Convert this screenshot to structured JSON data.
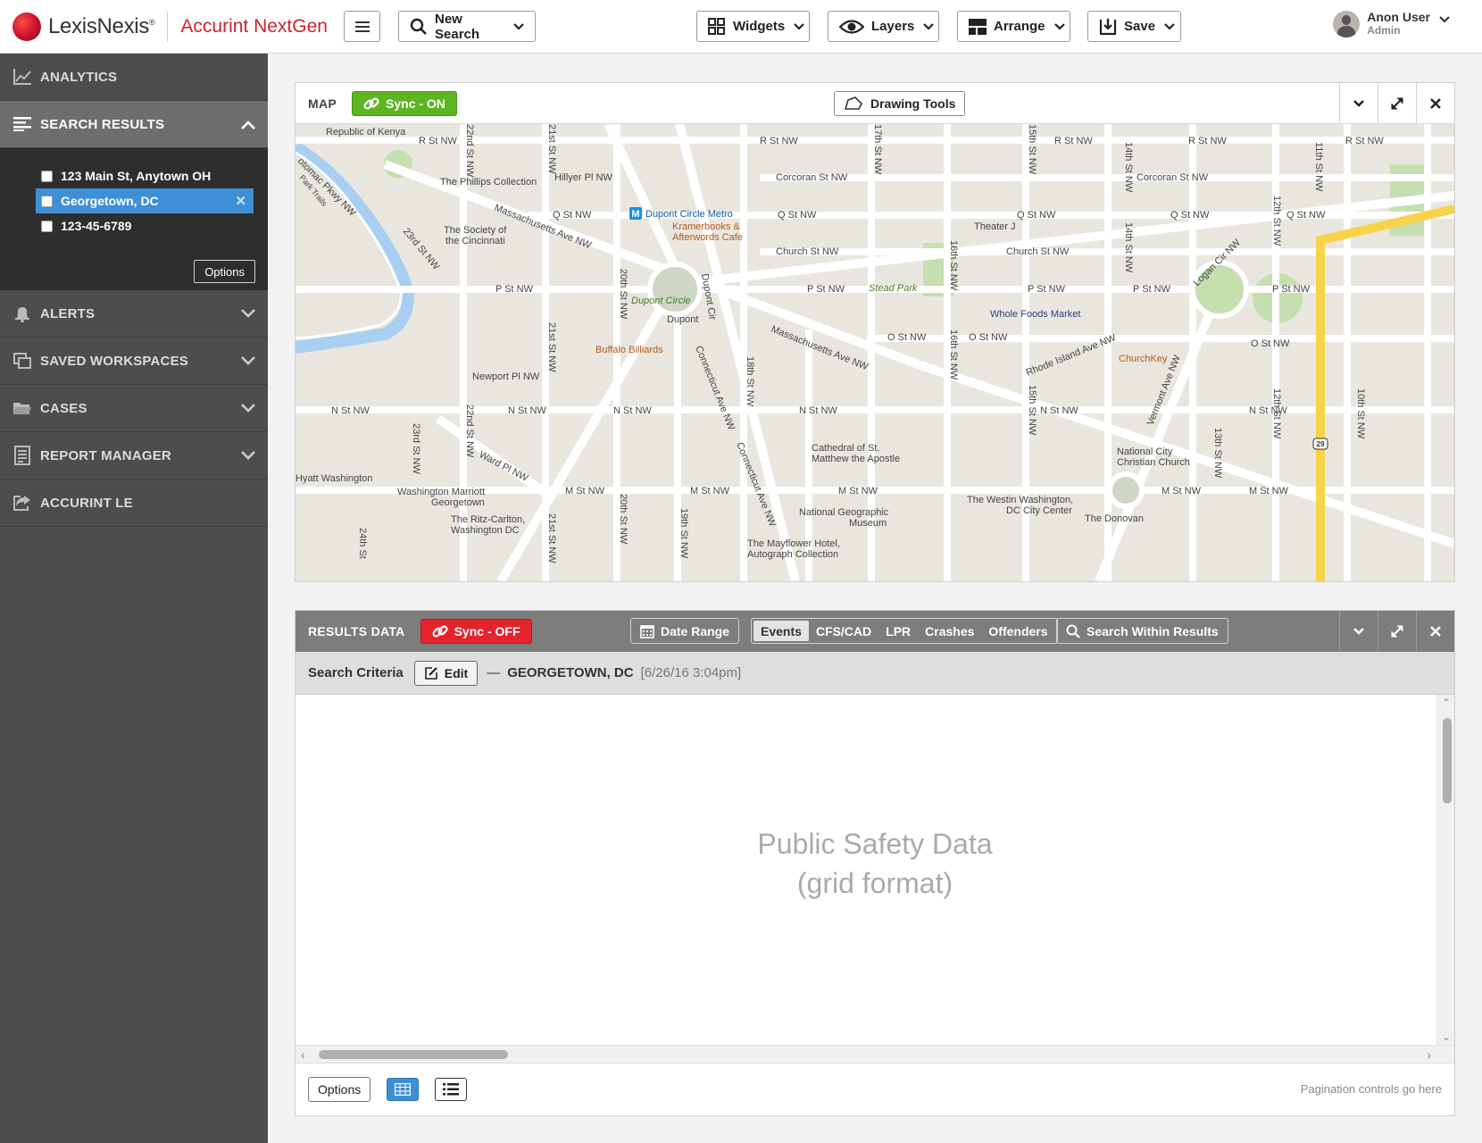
{
  "brand": {
    "company": "LexisNexis",
    "registered": "®",
    "product": "Accurint NextGen"
  },
  "toolbar": {
    "new_search": "New Search",
    "widgets": "Widgets",
    "layers": "Layers",
    "arrange": "Arrange",
    "save": "Save"
  },
  "user": {
    "name": "Anon User",
    "role": "Admin"
  },
  "sidebar": {
    "items": [
      {
        "label": "ANALYTICS",
        "icon": "chart-icon"
      },
      {
        "label": "SEARCH RESULTS",
        "icon": "list-icon"
      },
      {
        "label": "ALERTS",
        "icon": "bell-icon"
      },
      {
        "label": "SAVED WORKSPACES",
        "icon": "workspaces-icon"
      },
      {
        "label": "CASES",
        "icon": "folder-icon"
      },
      {
        "label": "REPORT MANAGER",
        "icon": "report-icon"
      },
      {
        "label": "ACCURINT LE",
        "icon": "share-icon"
      }
    ],
    "search_results": [
      {
        "label": "123 Main St, Anytown OH",
        "selected": false
      },
      {
        "label": "Georgetown, DC",
        "selected": true
      },
      {
        "label": "123-45-6789",
        "selected": false
      }
    ],
    "options_label": "Options"
  },
  "map_widget": {
    "title": "MAP",
    "sync_label": "Sync - ON",
    "drawing_tools": "Drawing Tools",
    "streets": {
      "r": "R St NW",
      "q": "Q St NW",
      "p": "P St NW",
      "o": "O St NW",
      "n": "N St NW",
      "m": "M St NW",
      "corcoran": "Corcoran St NW",
      "church": "Church St NW",
      "hillyer": "Hillyer Pl NW",
      "newport": "Newport Pl NW",
      "ward": "Ward Pl NW",
      "mass": "Massachusetts Ave NW",
      "conn": "Connecticut Ave NW",
      "rhode": "Rhode Island Ave NW",
      "vermont": "Vermont Ave NW",
      "logan": "Logan Cir NW",
      "potomac": "otomac Pkwy NW",
      "park_trails": "Park Trails",
      "s22": "22nd St NW",
      "s23": "23rd St NW",
      "s21": "21st St NW",
      "s20": "20th St NW",
      "s19": "19th St NW",
      "s18": "18th St NW",
      "s17": "17th St NW",
      "s16": "16th St NW",
      "s15": "15th St NW",
      "s14": "14th St NW",
      "s13": "13th St NW",
      "s12": "12th St NW",
      "s11": "11th St NW",
      "s10": "10th St NW",
      "s24": "24th St",
      "dupont": "Dupont",
      "dupont_cir": "Dupont Cir",
      "route": "29"
    },
    "places": {
      "kenya": "Republic of Kenya",
      "phillips": "The Phillips Collection",
      "society": "The Society of",
      "society2": "the Cincinnati",
      "metro": "Dupont Circle Metro",
      "kramer": "Kramerbooks &",
      "kramer2": "Afterwords Cafe",
      "dupont_circle": "Dupont Circle",
      "buffalo": "Buffalo Billiards",
      "theater": "Theater J",
      "stead": "Stead Park",
      "wholefoods": "Whole Foods Market",
      "churchkey": "ChurchKey",
      "cathedral": "Cathedral of St.",
      "cathedral2": "Matthew the Apostle",
      "natcity": "National City",
      "natcity2": "Christian Church",
      "hyatt": "Hyatt Washington",
      "marriott": "Washington Marriott",
      "marriott2": "Georgetown",
      "ritz": "The Ritz-Carlton,",
      "ritz2": "Washington DC",
      "natgeo": "National Geographic",
      "natgeo2": "Museum",
      "westin": "The Westin Washington,",
      "westin2": "DC City Center",
      "donovan": "The Donovan",
      "mayflower": "The Mayflower Hotel,",
      "mayflower2": "Autograph Collection"
    }
  },
  "results_widget": {
    "title": "RESULTS DATA",
    "sync_label": "Sync - OFF",
    "date_range": "Date Range",
    "tabs": [
      {
        "label": "Events",
        "active": true
      },
      {
        "label": "CFS/CAD",
        "active": false
      },
      {
        "label": "LPR",
        "active": false
      },
      {
        "label": "Crashes",
        "active": false
      },
      {
        "label": "Offenders",
        "active": false
      }
    ],
    "search_within": "Search Within Results",
    "criteria_label": "Search Criteria",
    "edit_label": "Edit",
    "criteria_dash": "—",
    "criteria_location": "GEORGETOWN, DC",
    "criteria_time": "[6/26/16 3:04pm]",
    "placeholder_line1": "Public Safety Data",
    "placeholder_line2": "(grid format)",
    "options_label": "Options",
    "pagination": "Pagination controls go here"
  },
  "colors": {
    "brand_red": "#d0202e",
    "sync_on": "#5cb521",
    "sync_off": "#e4232c",
    "selection_blue": "#3f8fd6",
    "sidebar_bg": "#4d4d4d"
  }
}
